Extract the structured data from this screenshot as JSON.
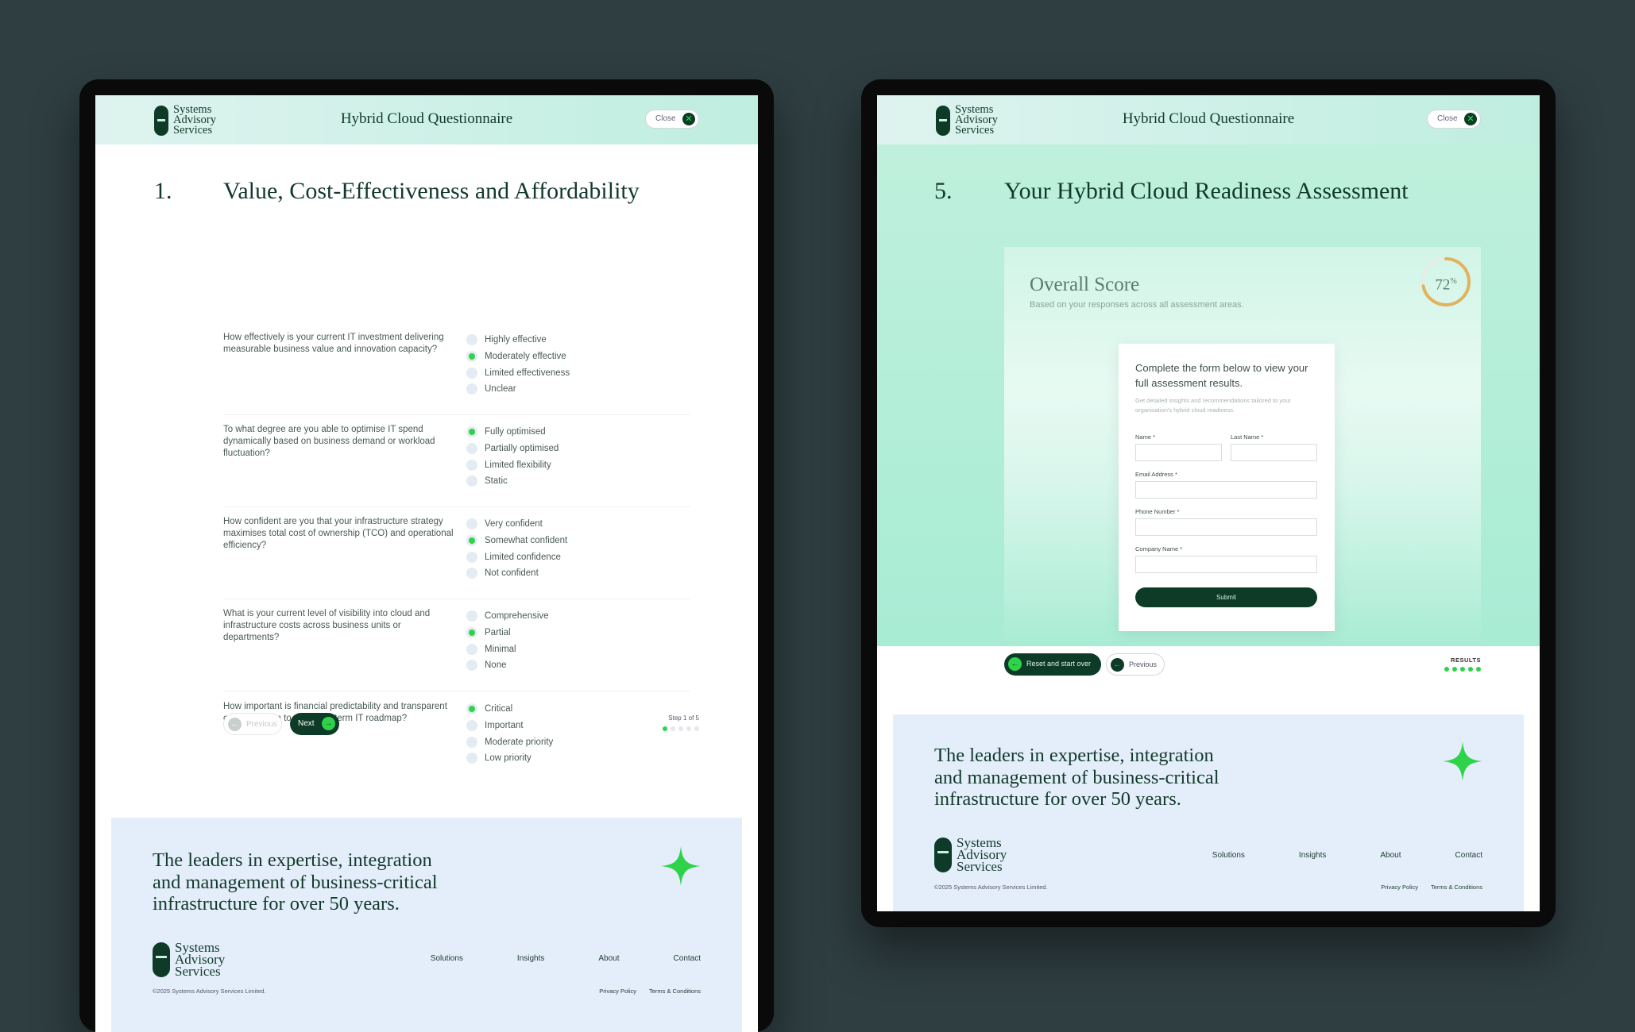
{
  "logo": {
    "line1": "Systems",
    "line2": "Advisory",
    "line3": "Services"
  },
  "header": {
    "title": "Hybrid Cloud Questionnaire",
    "close_label": "Close"
  },
  "left": {
    "section_number": "1.",
    "section_title": "Value, Cost-Effectiveness and Affordability",
    "questions": [
      {
        "text": "How effectively is your current IT investment delivering measurable business value and innovation capacity?",
        "options": [
          "Highly effective",
          "Moderately effective",
          "Limited effectiveness",
          "Unclear"
        ],
        "selected": 1
      },
      {
        "text": "To what degree are you able to optimise IT spend dynamically based on business demand or workload fluctuation?",
        "options": [
          "Fully optimised",
          "Partially optimised",
          "Limited flexibility",
          "Static"
        ],
        "selected": 0
      },
      {
        "text": "How confident are you that your infrastructure strategy maximises total cost of ownership (TCO) and operational efficiency?",
        "options": [
          "Very confident",
          "Somewhat confident",
          "Limited confidence",
          "Not confident"
        ],
        "selected": 1
      },
      {
        "text": "What is your current level of visibility into cloud and infrastructure costs across business units or departments?",
        "options": [
          "Comprehensive",
          "Partial",
          "Minimal",
          "None"
        ],
        "selected": 1
      },
      {
        "text": "How important is financial predictability and transparent cost allocation to your long-term IT roadmap?",
        "options": [
          "Critical",
          "Important",
          "Moderate priority",
          "Low priority"
        ],
        "selected": 0
      }
    ],
    "prev_label": "Previous",
    "next_label": "Next",
    "step_label": "Step 1 of 5",
    "step_total": 5,
    "step_current": 1
  },
  "right": {
    "section_number": "5.",
    "section_title": "Your Hybrid Cloud Readiness Assessment",
    "score_title": "Overall Score",
    "score_sub": "Based on your responses across all assessment areas.",
    "score_value": "72",
    "score_unit": "%",
    "score_fraction": 0.72,
    "form_heading": "Complete the form below to view your full assessment results.",
    "form_sub": "Get detailed insights and recommendations tailored to your organisation's hybrid cloud readiness.",
    "fields": {
      "name": "Name *",
      "last_name": "Last Name *",
      "email": "Email Address *",
      "phone": "Phone Number *",
      "company": "Company Name *"
    },
    "submit_label": "Submit",
    "reset_label": "Reset and start over",
    "prev_label": "Previous",
    "results_label": "RESULTS"
  },
  "footer": {
    "tagline": "The leaders in expertise, integration\nand management of business-critical\ninfrastructure for over 50 years.",
    "links": [
      "Solutions",
      "Insights",
      "About",
      "Contact"
    ],
    "copyright": "©2025 Systems Advisory Services Limited.",
    "legal": [
      "Privacy Policy",
      "Terms & Conditions"
    ]
  },
  "colors": {
    "accent": "#2ed34a",
    "brand_dark": "#0d3b27",
    "background": "#2f3e41"
  }
}
